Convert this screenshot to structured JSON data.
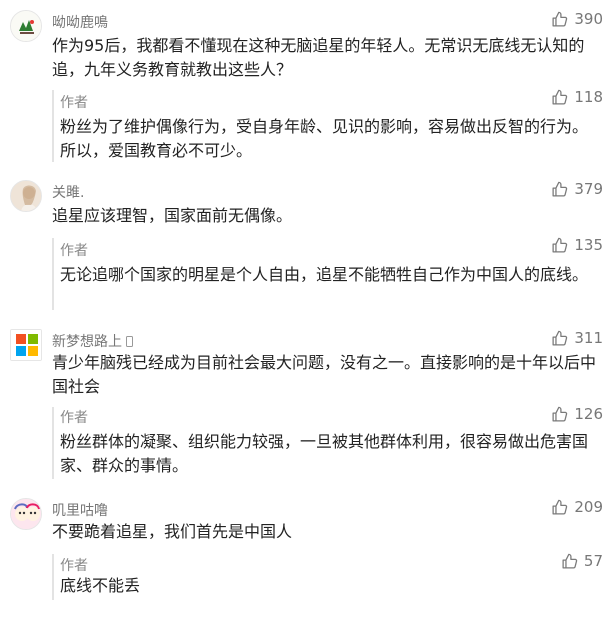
{
  "comments": [
    {
      "user": "呦呦鹿鳴",
      "likes": "390",
      "text": "作为95后，我都看不懂现在这种无脑追星的年轻人。无常识无底线无认知的追，九年义务教育就教出这些人？",
      "reply": {
        "author": "作者",
        "likes": "118",
        "text": "粉丝为了维护偶像行为，受自身年龄、见识的影响，容易做出反智的行为。所以，爱国教育必不可少。"
      }
    },
    {
      "user": "关雎.",
      "likes": "379",
      "text": "追星应该理智，国家面前无偶像。",
      "reply": {
        "author": "作者",
        "likes": "135",
        "text": "无论追哪个国家的明星是个人自由，追星不能牺牲自己作为中国人的底线。"
      }
    },
    {
      "user": "新梦想路上",
      "likes": "311",
      "text": "青少年脑残已经成为目前社会最大问题，没有之一。直接影响的是十年以后中国社会",
      "reply": {
        "author": "作者",
        "likes": "126",
        "text": "粉丝群体的凝聚、组织能力较强，一旦被其他群体利用，很容易做出危害国家、群众的事情。"
      }
    },
    {
      "user": "叽里咕噜",
      "likes": "209",
      "text": "不要跪着追星，我们首先是中国人",
      "reply": {
        "author": "作者",
        "likes": "57",
        "text": "底线不能丢"
      }
    }
  ],
  "icons": {
    "like": "thumbs-up-icon",
    "device": "phone-icon"
  },
  "colors": {
    "meta_text": "#777777",
    "body_text": "#222222",
    "reply_border": "#e3e3e3"
  }
}
